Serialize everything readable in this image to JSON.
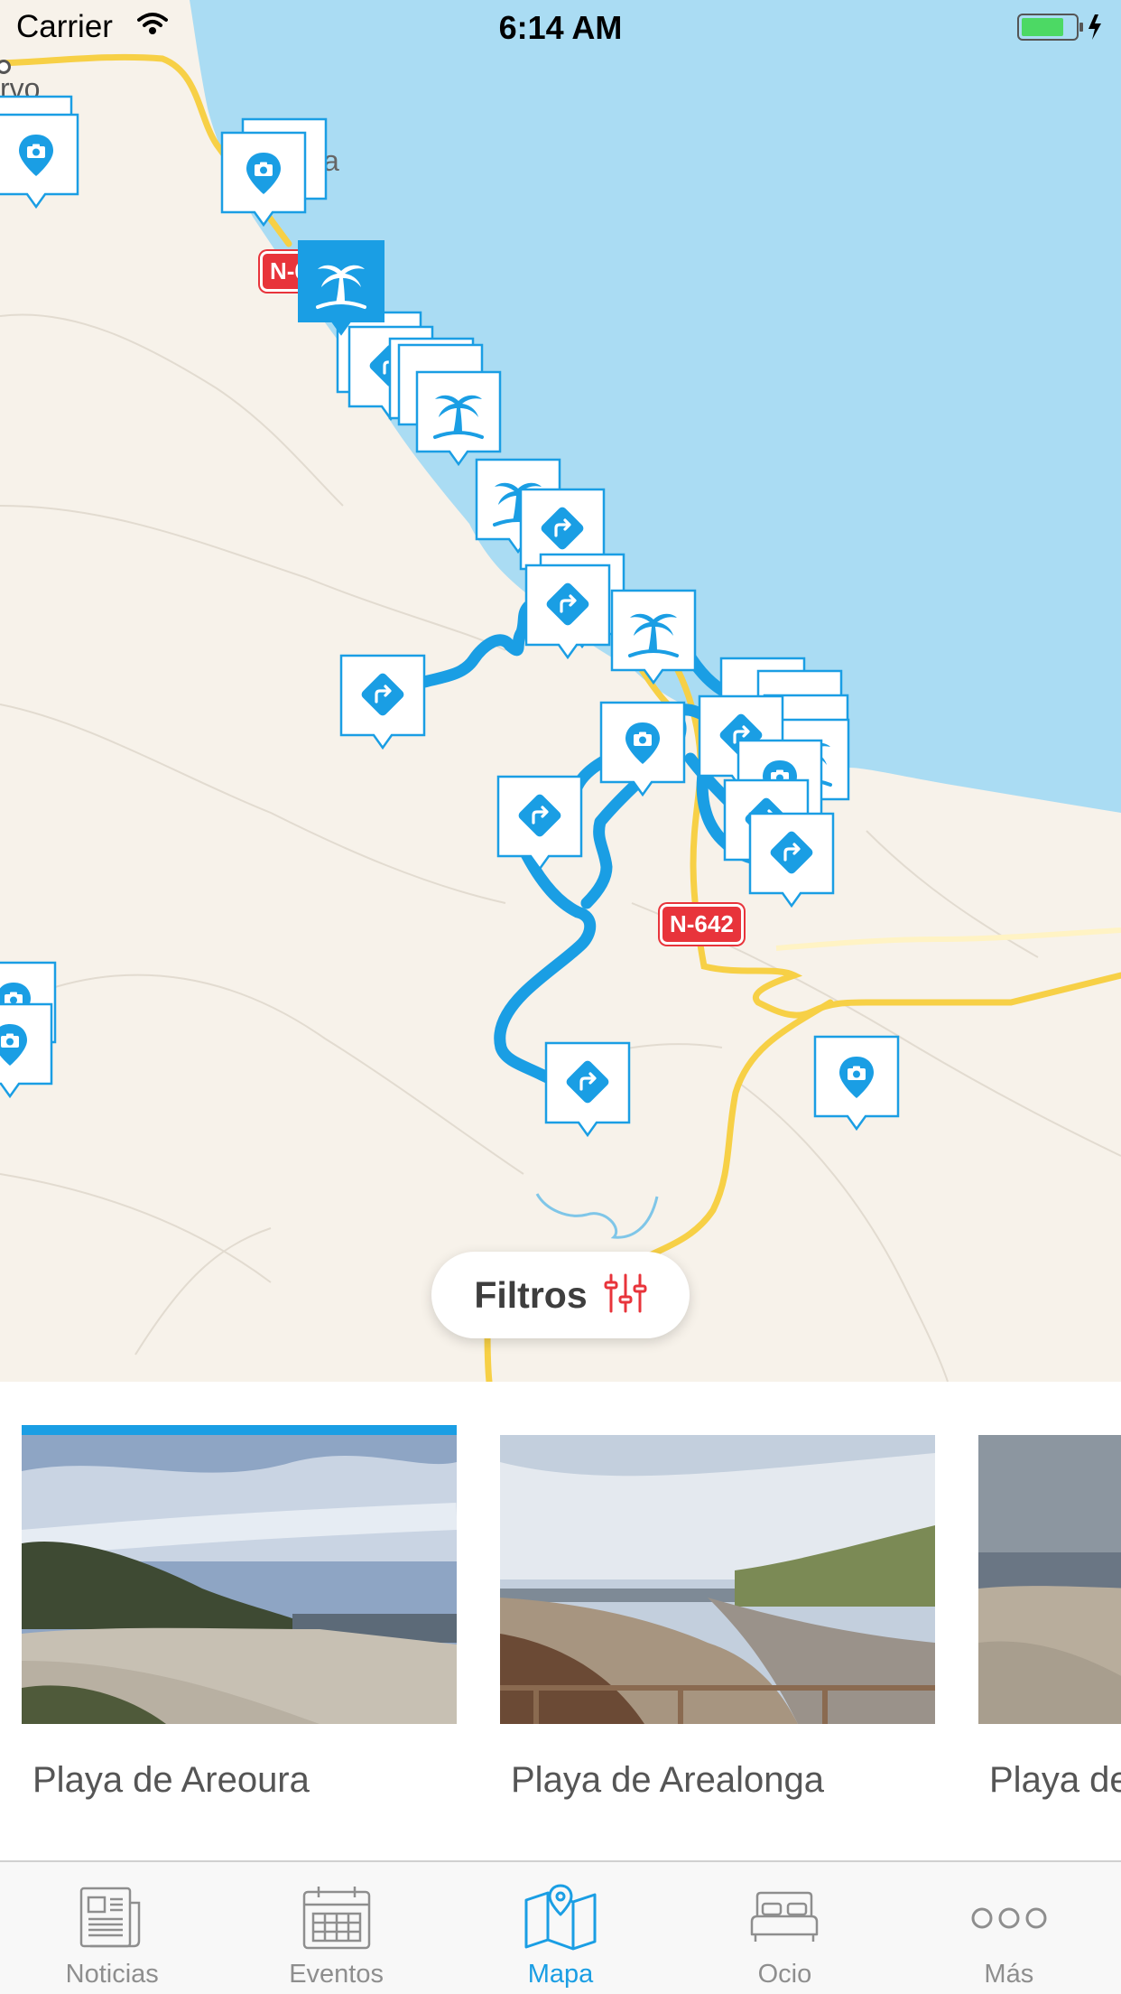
{
  "status_bar": {
    "carrier": "Carrier",
    "time": "6:14 AM"
  },
  "map": {
    "colors": {
      "land": "#f7f2ea",
      "sea": "#aadcf3",
      "route": "#1a9ee4",
      "road": "#f7d046",
      "road_badge": "#e8343b"
    },
    "road_badges": [
      "N-6",
      "N-642"
    ],
    "place_fragment": "a",
    "place_fragment_2": "rvo"
  },
  "filters": {
    "label": "Filtros"
  },
  "carousel": {
    "cards": [
      {
        "title": "Playa de Areoura",
        "selected": true
      },
      {
        "title": "Playa de Arealonga",
        "selected": false
      },
      {
        "title": "Playa de",
        "selected": false
      }
    ]
  },
  "tabbar": {
    "active_color": "#1a9ee4",
    "items": [
      {
        "label": "Noticias",
        "icon": "newspaper-icon"
      },
      {
        "label": "Eventos",
        "icon": "calendar-icon"
      },
      {
        "label": "Mapa",
        "icon": "map-pin-icon",
        "active": true
      },
      {
        "label": "Ocio",
        "icon": "bed-icon"
      },
      {
        "label": "Más",
        "icon": "more-dots-icon"
      }
    ]
  }
}
